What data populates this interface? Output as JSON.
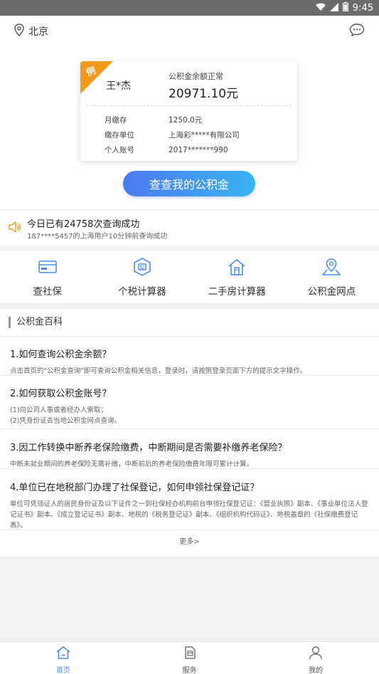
{
  "statusbar": {
    "time": "9:45"
  },
  "header": {
    "city": "北京"
  },
  "card": {
    "badge": "例",
    "name": "王*杰",
    "status": "公积金余额正常",
    "amount": "20971.10元",
    "rows": [
      {
        "key": "月缴存",
        "value": "1250.0元"
      },
      {
        "key": "缴存单位",
        "value": "上海彩*****有限公司"
      },
      {
        "key": "个人账号",
        "value": "2017*******990"
      }
    ]
  },
  "query_button": "查查我的公积金",
  "notice": {
    "line1": "今日已有24758次查询成功",
    "line2": "187****5457的上海用户10分钟前查询成功"
  },
  "services": [
    {
      "label": "查社保",
      "icon": "card-icon"
    },
    {
      "label": "个税计算器",
      "icon": "tax-icon"
    },
    {
      "label": "二手房计算器",
      "icon": "house-icon"
    },
    {
      "label": "公积金网点",
      "icon": "location-icon"
    }
  ],
  "wiki": {
    "title": "公积金百科",
    "items": [
      {
        "q": "1.如何查询公积金余额？",
        "a": "点击首页的\"公积金查询\"即可查询公积金相关信息，登录时，请按照登录页面下方的提示文字操作。"
      },
      {
        "q": "2.如何获取公积金账号？",
        "a1": "(1)向公司人事或者经办人索取；",
        "a2": "(2)凭身份证去当地公积金网点查询。"
      },
      {
        "q": "3.因工作转换中断养老保险缴费，中断期间是否需要补缴养老保险？",
        "a": "中断未就业期间的养老保险无需补缴，中断前后的养老保险缴费年限可累计计算。"
      },
      {
        "q": "4.单位已在地税部门办理了社保登记，如何申领社保登记证？",
        "a": "单位可凭领证人的居民身份证及以下证件之一到社保经办机构前台申领社保登记证：《营业执照》副本、《事业单位法人登记证书》副本、《成立登记证书》副本、地税的《税务登记证》副本、《组织机构代码证》、地税盖章的《社保缴费登记表》。"
      }
    ],
    "more": "更多>"
  },
  "tabs": [
    {
      "label": "首页",
      "active": true
    },
    {
      "label": "服务",
      "active": false
    },
    {
      "label": "我的",
      "active": false
    }
  ],
  "colors": {
    "accent": "#4a8cf0",
    "badge": "#f39a1e"
  }
}
